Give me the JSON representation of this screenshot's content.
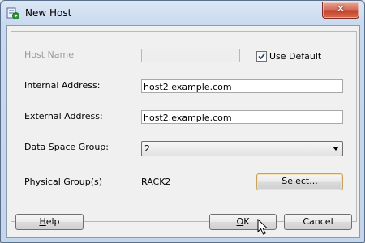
{
  "window": {
    "title": "New Host",
    "close_glyph": "✕",
    "app_icon": "host-app-icon"
  },
  "form": {
    "host_name": {
      "label": "Host Name",
      "value": "",
      "use_default_label": "Use Default",
      "use_default_checked": true
    },
    "internal_address": {
      "label": "Internal Address:",
      "value": "host2.example.com"
    },
    "external_address": {
      "label": "External Address:",
      "value": "host2.example.com"
    },
    "data_space_group": {
      "label": "Data Space Group:",
      "value": "2"
    },
    "physical_groups": {
      "label": "Physical Group(s)",
      "value": "RACK2",
      "select_label": "Select..."
    }
  },
  "buttons": {
    "help": {
      "prefix": "",
      "mnemonic": "H",
      "rest": "elp"
    },
    "ok": {
      "prefix": "",
      "mnemonic": "O",
      "rest": "K"
    },
    "cancel": "Cancel"
  },
  "colors": {
    "focus_border": "#c9a35a",
    "check_color": "#1f3f7a",
    "close_red": "#c2402a"
  }
}
